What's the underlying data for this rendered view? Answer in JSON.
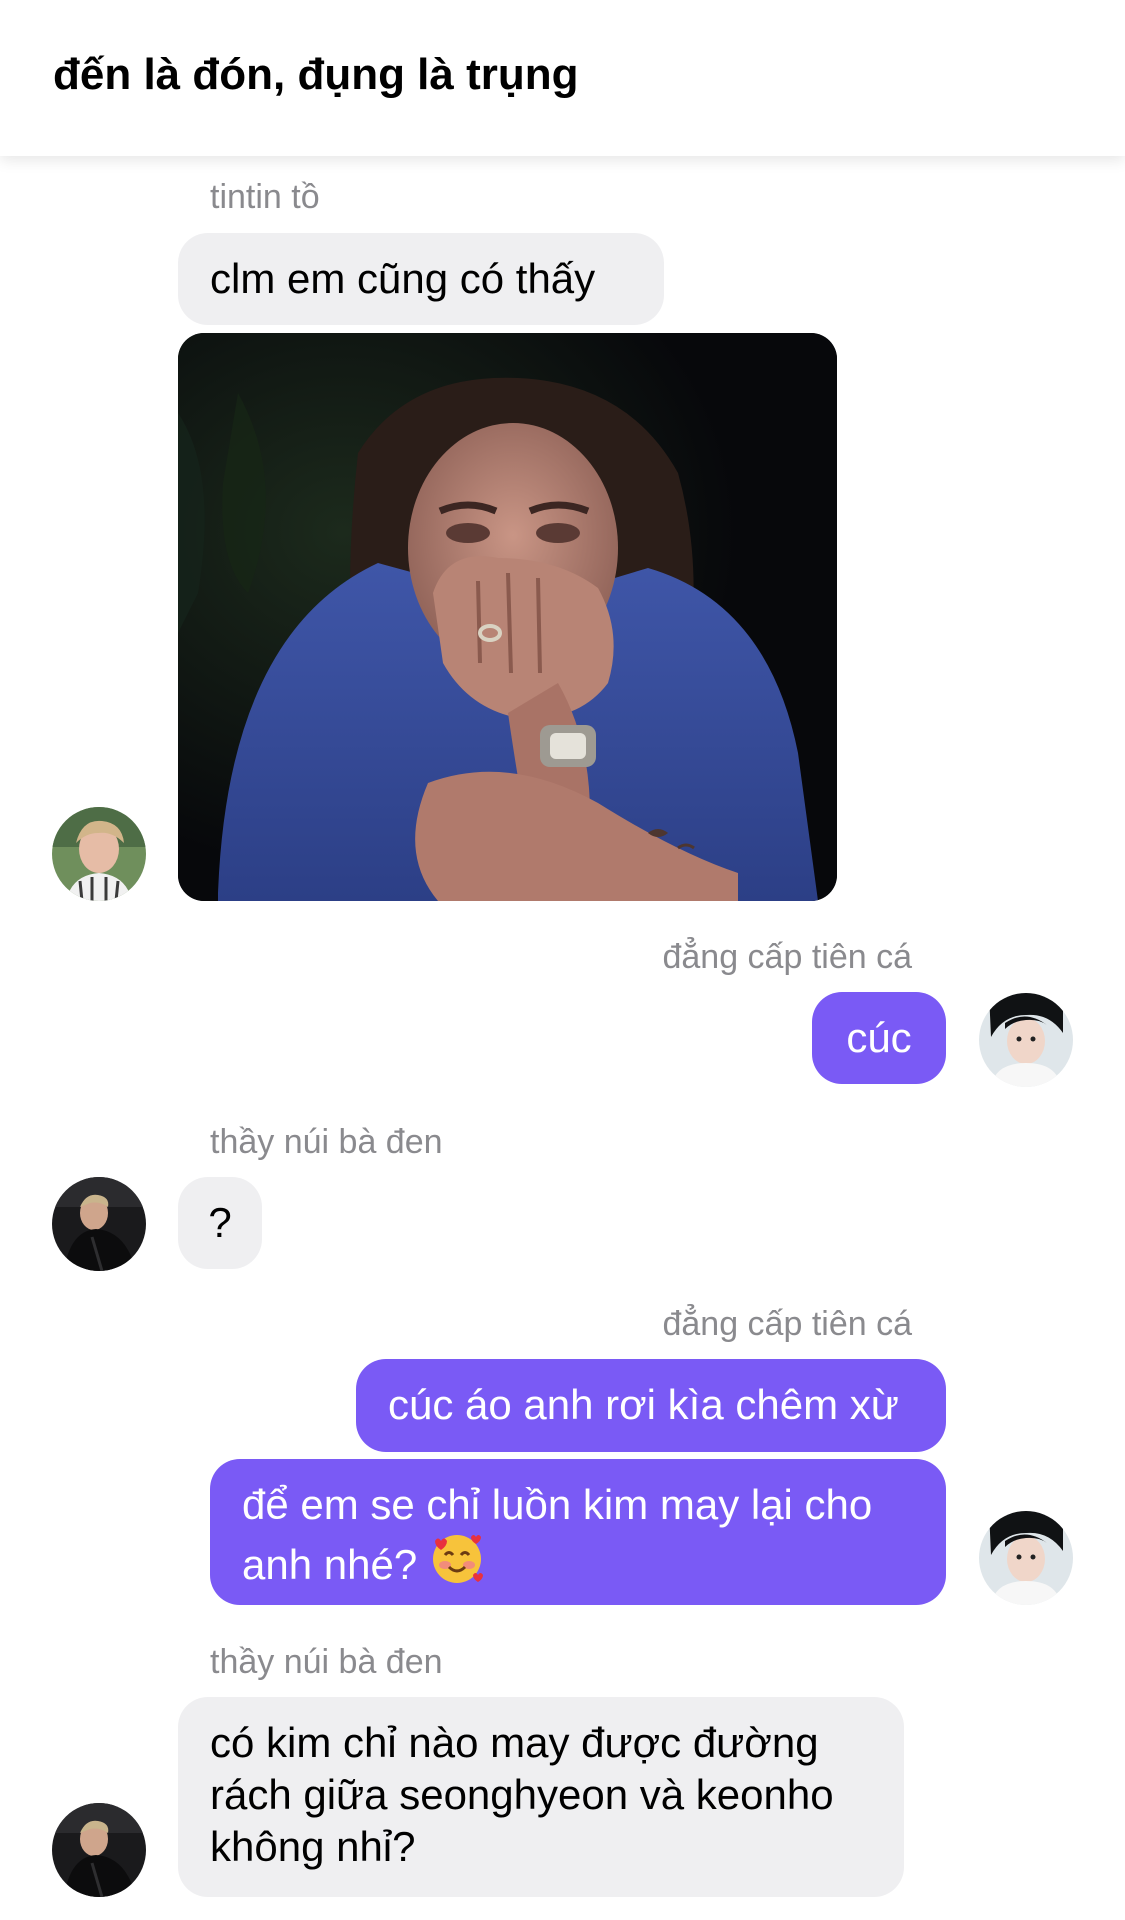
{
  "header": {
    "title": "đến là đón, đụng là trụng"
  },
  "colors": {
    "outgoing_bubble": "#7a5af5",
    "incoming_bubble": "#efeff1",
    "sender_name": "#8a8a8e"
  },
  "messages": [
    {
      "sender": "tintin tồ",
      "direction": "incoming",
      "text": "clm em cũng có thấy"
    },
    {
      "sender": "tintin tồ",
      "direction": "incoming",
      "type": "image",
      "content": "photo-man-covering-mouth"
    },
    {
      "sender": "đẳng cấp tiên cá",
      "direction": "outgoing",
      "text": "cúc"
    },
    {
      "sender": "thầy núi bà đen",
      "direction": "incoming",
      "text": "?"
    },
    {
      "sender": "đẳng cấp tiên cá",
      "direction": "outgoing",
      "text": "cúc áo anh rơi kìa chêm xừ"
    },
    {
      "sender": "đẳng cấp tiên cá",
      "direction": "outgoing",
      "lines": [
        "để em se chỉ luồn kim may lại cho",
        "anh nhé? "
      ],
      "emoji": "smiling-face-with-hearts-icon"
    },
    {
      "sender": "thầy núi bà đen",
      "direction": "incoming",
      "lines": [
        "có kim chỉ nào may được đường",
        "rách giữa seonghyeon và keonho",
        "không nhỉ?"
      ]
    }
  ]
}
